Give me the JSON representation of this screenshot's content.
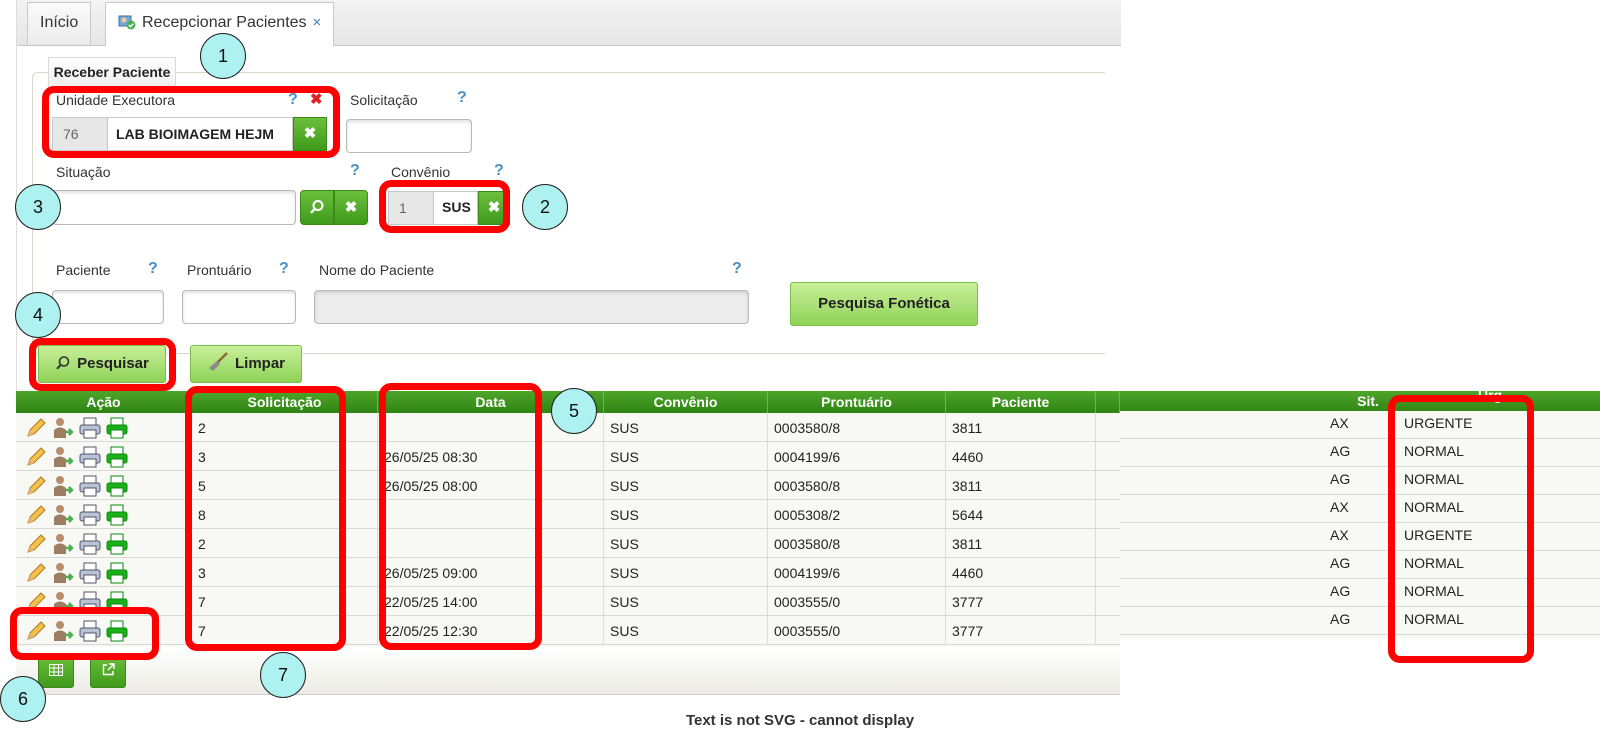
{
  "tabs": [
    {
      "label": "Início"
    },
    {
      "label": "Recepcionar Pacientes",
      "close": "×"
    }
  ],
  "form": {
    "legend": "Receber Paciente",
    "help": "?",
    "unidade": {
      "label": "Unidade Executora",
      "code": "76",
      "value": "LAB BIOIMAGEM HEJM"
    },
    "solicitacao": {
      "label": "Solicitação",
      "value": ""
    },
    "situacao": {
      "label": "Situação",
      "value": ""
    },
    "convenio": {
      "label": "Convênio",
      "code": "1",
      "value": "SUS"
    },
    "paciente": {
      "label": "Paciente"
    },
    "prontuario": {
      "label": "Prontuário"
    },
    "nome": {
      "label": "Nome do Paciente"
    },
    "fonetica_label": "Pesquisa Fonética",
    "pesquisar_label": "Pesquisar",
    "limpar_label": "Limpar"
  },
  "table": {
    "columns": [
      "Ação",
      "Solicitação",
      "Data",
      "Convênio",
      "Prontuário",
      "Paciente"
    ],
    "extra_columns": [
      "Sit.",
      "Urg"
    ],
    "rows": [
      {
        "solicitacao": "2",
        "data": "",
        "convenio": "SUS",
        "prontuario": "0003580/8",
        "paciente": "3811",
        "sit": "AX",
        "urg": "URGENTE"
      },
      {
        "solicitacao": "3",
        "data": "26/05/25 08:30",
        "convenio": "SUS",
        "prontuario": "0004199/6",
        "paciente": "4460",
        "sit": "AG",
        "urg": "NORMAL"
      },
      {
        "solicitacao": "5",
        "data": "26/05/25 08:00",
        "convenio": "SUS",
        "prontuario": "0003580/8",
        "paciente": "3811",
        "sit": "AG",
        "urg": "NORMAL"
      },
      {
        "solicitacao": "8",
        "data": "",
        "convenio": "SUS",
        "prontuario": "0005308/2",
        "paciente": "5644",
        "sit": "AX",
        "urg": "NORMAL"
      },
      {
        "solicitacao": "2",
        "data": "",
        "convenio": "SUS",
        "prontuario": "0003580/8",
        "paciente": "3811",
        "sit": "AX",
        "urg": "URGENTE"
      },
      {
        "solicitacao": "3",
        "data": "26/05/25 09:00",
        "convenio": "SUS",
        "prontuario": "0004199/6",
        "paciente": "4460",
        "sit": "AG",
        "urg": "NORMAL"
      },
      {
        "solicitacao": "7",
        "data": "22/05/25 14:00",
        "convenio": "SUS",
        "prontuario": "0003555/0",
        "paciente": "3777",
        "sit": "AG",
        "urg": "NORMAL"
      },
      {
        "solicitacao": "7",
        "data": "22/05/25 12:30",
        "convenio": "SUS",
        "prontuario": "0003555/0",
        "paciente": "3777",
        "sit": "AG",
        "urg": "NORMAL"
      }
    ]
  },
  "markers": [
    "1",
    "2",
    "3",
    "4",
    "5",
    "6",
    "7"
  ],
  "caption": "Text is not SVG - cannot display",
  "colors": {
    "accent_green": "#3f9a1b",
    "highlight_red": "#ff0000",
    "marker_cyan": "#aef1f1"
  }
}
